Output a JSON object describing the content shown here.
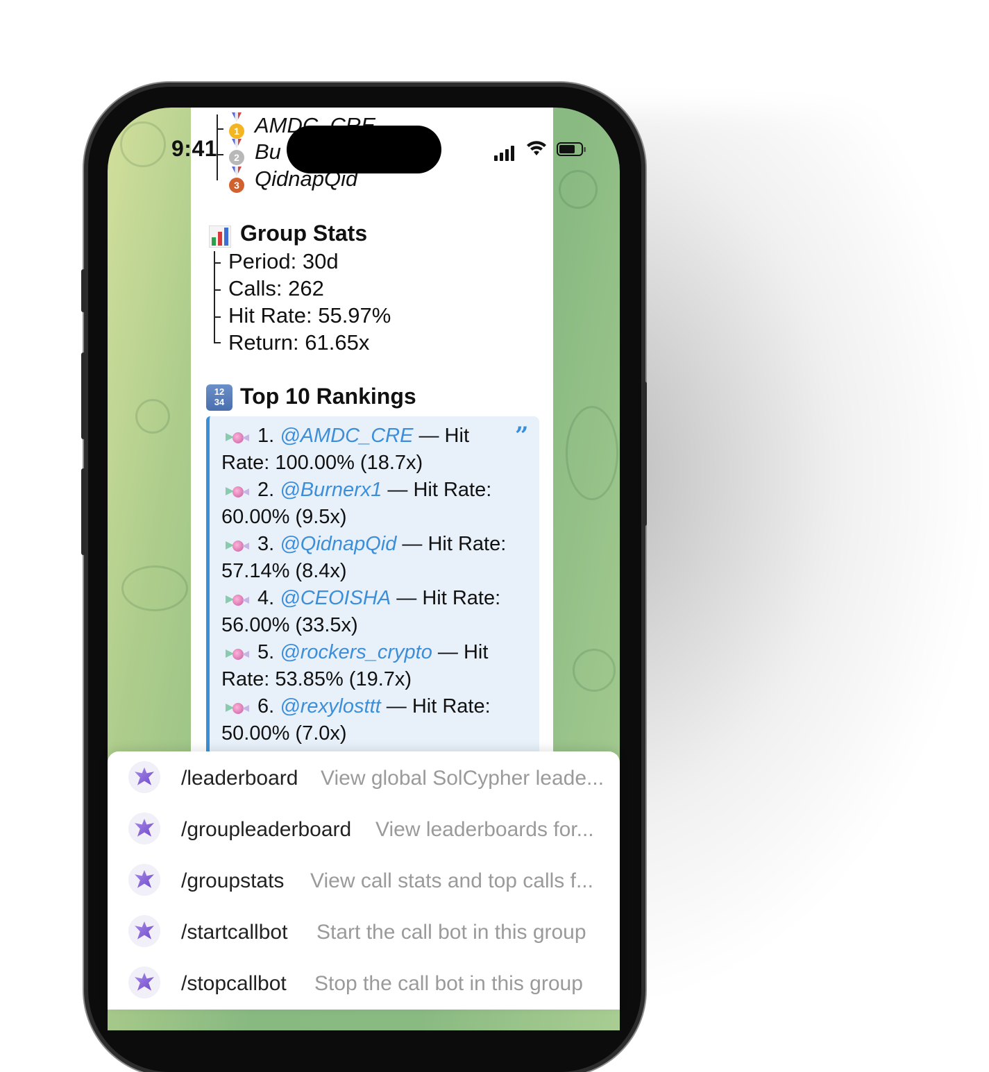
{
  "status_bar": {
    "time": "9:41"
  },
  "top_calls": {
    "entries": [
      {
        "rank": "1",
        "medal": "gold",
        "name": "AMDC_CRE"
      },
      {
        "rank": "2",
        "medal": "silver",
        "name": "Bu"
      },
      {
        "rank": "3",
        "medal": "bronze",
        "name": "QidnapQid"
      }
    ]
  },
  "group_stats": {
    "title": "Group Stats",
    "lines": [
      "Period: 30d",
      "Calls: 262",
      "Hit Rate: 55.97%",
      "Return: 61.65x"
    ]
  },
  "rankings": {
    "title": "Top 10 Rankings",
    "icon_text": [
      "12",
      "34"
    ],
    "items": [
      {
        "num": "1.",
        "user": "@AMDC_CRE",
        "rest1": " — Hit",
        "line2": "Rate: 100.00% (18.7x)"
      },
      {
        "num": "2.",
        "user": "@Burnerx1",
        "rest1": " — Hit Rate:",
        "line2": "60.00% (9.5x)"
      },
      {
        "num": "3.",
        "user": "@QidnapQid",
        "rest1": " — Hit Rate:",
        "line2": "57.14% (8.4x)"
      },
      {
        "num": "4.",
        "user": "@CEOISHA",
        "rest1": " — Hit Rate:",
        "line2": "56.00% (33.5x)"
      },
      {
        "num": "5.",
        "user": "@rockers_crypto",
        "rest1": " — Hit",
        "line2": "Rate: 53.85% (19.7x)"
      },
      {
        "num": "6.",
        "user": "@rexylosttt",
        "rest1": " — Hit Rate:",
        "line2": "50.00% (7.0x)"
      }
    ]
  },
  "commands": [
    {
      "command": "/leaderboard",
      "description": "View global SolCypher leade..."
    },
    {
      "command": "/groupleaderboard",
      "description": "View leaderboards for..."
    },
    {
      "command": "/groupstats",
      "description": "View call stats and top calls f..."
    },
    {
      "command": "/startcallbot",
      "description": "Start the call bot in this group"
    },
    {
      "command": "/stopcallbot",
      "description": "Stop the call bot in this group"
    }
  ],
  "colors": {
    "mention": "#3d8ed8",
    "quote_border": "#3b8fd8",
    "quote_bg": "#e8f1fa",
    "chat_bg": "#89ba82"
  },
  "icons": [
    "signal-icon",
    "wifi-icon",
    "battery-icon",
    "bar-chart-icon",
    "numbers-icon",
    "candy-icon",
    "bot-avatar-icon",
    "medal-icon"
  ]
}
